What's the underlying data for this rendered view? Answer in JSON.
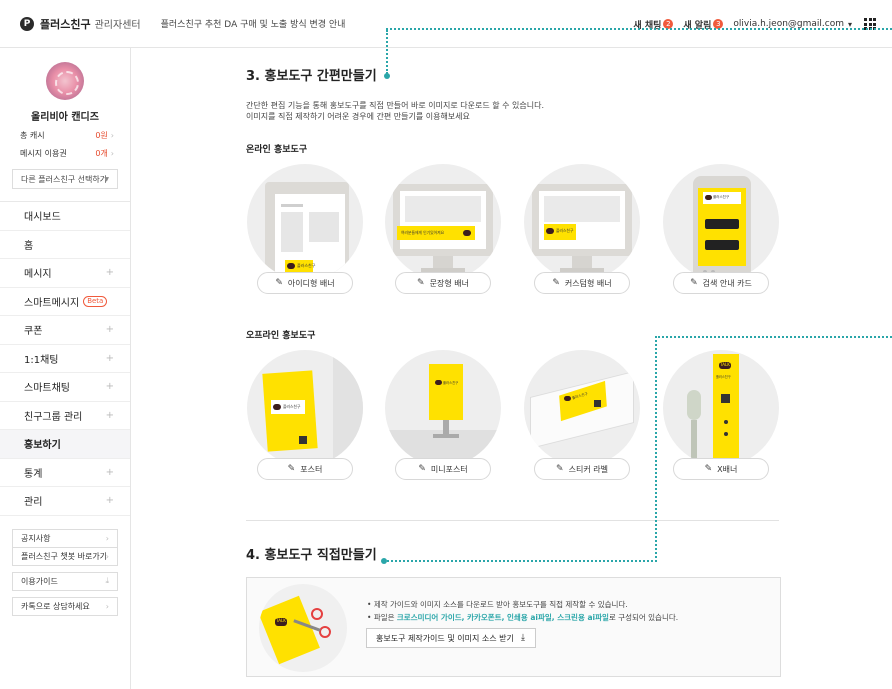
{
  "header": {
    "logo_mark": "P",
    "logo_title": "플러스친구",
    "logo_sub": "관리자센터",
    "notice": "플러스친구 추천 DA 구매 및 노출 방식 변경 안내",
    "new_chat_label": "새 채팅",
    "new_chat_count": "2",
    "new_alert_label": "새 알림",
    "new_alert_count": "3",
    "account_email": "olivia.h.jeon@gmail.com",
    "caret": "▾"
  },
  "sidebar": {
    "profile_name": "올리비아 캔디즈",
    "stats": [
      {
        "label": "총 캐시",
        "value": "0원"
      },
      {
        "label": "메시지 이용권",
        "value": "0개"
      }
    ],
    "friend_select": "다른 플러스친구 선택하기",
    "nav": [
      {
        "label": "대시보드",
        "expandable": false,
        "active": false
      },
      {
        "label": "홈",
        "expandable": false,
        "active": false
      },
      {
        "label": "메시지",
        "expandable": true,
        "active": false
      },
      {
        "label": "스마트메시지",
        "expandable": false,
        "active": false,
        "badge": "Beta"
      },
      {
        "label": "쿠폰",
        "expandable": true,
        "active": false
      },
      {
        "label": "1:1채팅",
        "expandable": true,
        "active": false
      },
      {
        "label": "스마트채팅",
        "expandable": true,
        "active": false
      },
      {
        "label": "친구그룹 관리",
        "expandable": true,
        "active": false
      },
      {
        "label": "홍보하기",
        "expandable": false,
        "active": true
      },
      {
        "label": "통계",
        "expandable": true,
        "active": false
      },
      {
        "label": "관리",
        "expandable": true,
        "active": false
      }
    ],
    "links": [
      {
        "label": "공지사항",
        "icon": "chevron-right"
      },
      {
        "label": "플러스친구 챗봇 바로가기",
        "icon": "chevron-right"
      },
      {
        "label": "이용가이드",
        "icon": "download"
      },
      {
        "label": "카톡으로 상담하세요",
        "icon": "chevron-right"
      }
    ]
  },
  "main": {
    "section3_title": "3. 홍보도구 간편만들기",
    "section3_desc_1": "간단한 편집 기능을 통해 홍보도구를 직접 만들어 바로 이미지로 다운로드 할 수 있습니다.",
    "section3_desc_2": "이미지를 직접 제작하기 어려운 경우에 간편 만들기를 이용해보세요",
    "online_title": "온라인 홍보도구",
    "online_tools": [
      {
        "label": "아이디형 배너",
        "art_text": "플러스친구"
      },
      {
        "label": "문장형 배너",
        "art_text": "여러분들에게 인기있어져요"
      },
      {
        "label": "커스텀형 배너",
        "art_text": "플러스친구"
      },
      {
        "label": "검색 안내 카드",
        "art_text": "플러스친구"
      }
    ],
    "offline_title": "오프라인 홍보도구",
    "offline_tools": [
      {
        "label": "포스터",
        "art_text": "플러스친구"
      },
      {
        "label": "미니포스터",
        "art_text": "플러스친구"
      },
      {
        "label": "스티커 라벨",
        "art_text": "플러스친구"
      },
      {
        "label": "X배너",
        "art_text": "플러스친구"
      }
    ],
    "talk_badge": "TALK",
    "section4_title": "4. 홍보도구 직접만들기",
    "guide_line1": "제작 가이드와 이미지 소스를 다운로드 받아 홍보도구를 직접 제작할 수 있습니다.",
    "guide_line2_pre": "파일은 ",
    "guide_line2_hl": "크로스미디어 가이드, 카카오폰트, 인쇄용 ai파일, 스크린용 ai파일",
    "guide_line2_post": "로 구성되어 있습니다.",
    "guide_button": "홍보도구 제작가이드 및 이미지 소스 받기",
    "download_glyph": "⤓"
  },
  "colors": {
    "accent_teal": "#2aa6a9",
    "kakao_yellow": "#ffe100",
    "alert_red": "#f05a3c"
  }
}
